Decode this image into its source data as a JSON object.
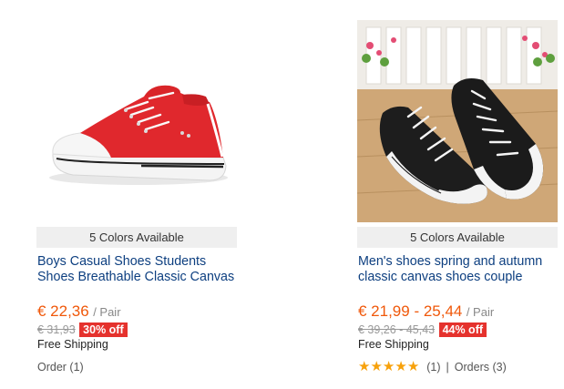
{
  "products": [
    {
      "colors_label": "5 Colors Available",
      "title": "Boys Casual Shoes Students Shoes Breathable Classic Canvas",
      "price": "€ 22,36",
      "unit": "/ Pair",
      "original_price": "€ 31,93",
      "discount": "30% off",
      "shipping": "Free Shipping",
      "orders": "Order (1)",
      "image_icon": "red-canvas-sneaker-icon"
    },
    {
      "colors_label": "5 Colors Available",
      "title": "Men's shoes spring and autumn classic canvas shoes couple",
      "price": "€ 21,99 - 25,44",
      "unit": "/ Pair",
      "original_price": "€ 39,26 - 45,43",
      "discount": "44% off",
      "shipping": "Free Shipping",
      "rating_stars": 5,
      "rating_count": "(1)",
      "separator": "|",
      "orders": "Orders (3)",
      "image_icon": "black-canvas-sneakers-icon"
    }
  ],
  "colors": {
    "price": "#f0580a",
    "title_link": "#0d3f80",
    "discount_badge": "#e5322d",
    "star": "#f7a10b"
  }
}
